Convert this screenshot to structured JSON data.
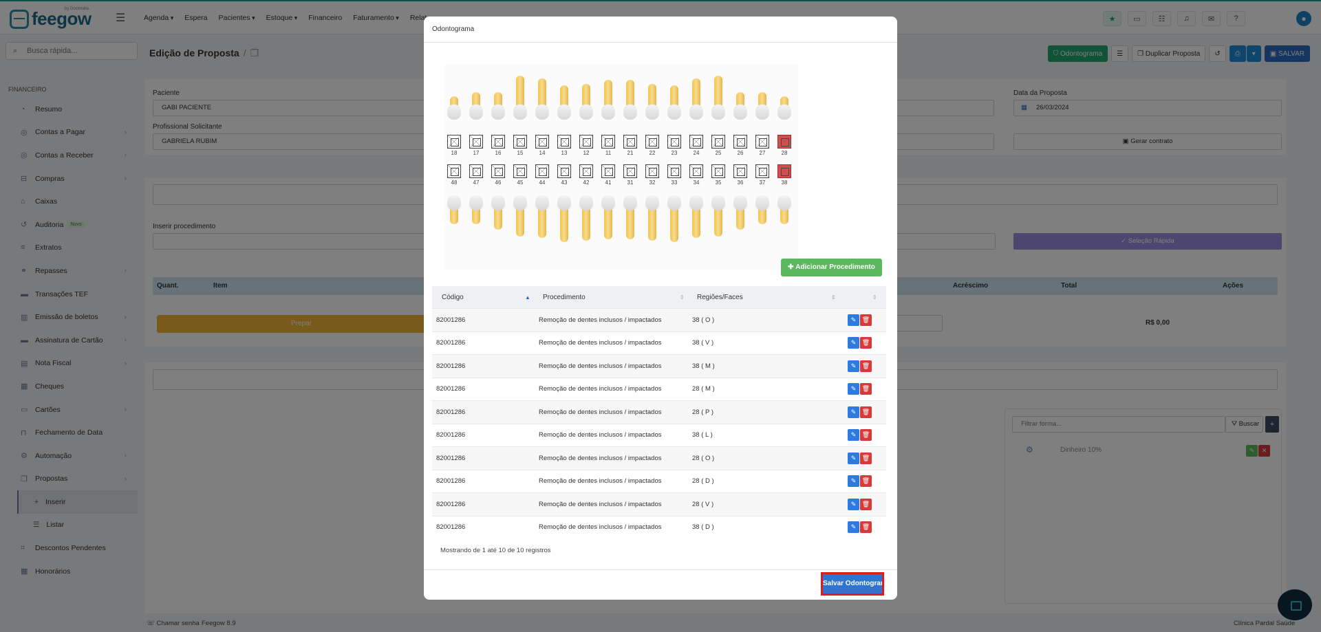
{
  "app": {
    "brand": "feegow",
    "brand_sub": "by Doctoralia"
  },
  "topnav": [
    "Agenda",
    "Espera",
    "Pacientes",
    "Estoque",
    "Financeiro",
    "Faturamento",
    "Relat"
  ],
  "sidebar": {
    "search_placeholder": "Busca rápida...",
    "section": "FINANCEIRO",
    "items": [
      {
        "label": "Resumo",
        "icon": "gauge-icon",
        "chevron": false
      },
      {
        "label": "Contas a Pagar",
        "icon": "coins-icon",
        "chevron": true
      },
      {
        "label": "Contas a Receber",
        "icon": "coins-icon",
        "chevron": true
      },
      {
        "label": "Compras",
        "icon": "cart-icon",
        "chevron": true
      },
      {
        "label": "Caixas",
        "icon": "inbox-icon",
        "chevron": false
      },
      {
        "label": "Auditoria",
        "icon": "history-icon",
        "chevron": false,
        "badge": "Novo"
      },
      {
        "label": "Extratos",
        "icon": "list-icon",
        "chevron": false
      },
      {
        "label": "Repasses",
        "icon": "handshake-icon",
        "chevron": true
      },
      {
        "label": "Transações TEF",
        "icon": "card-icon",
        "chevron": false
      },
      {
        "label": "Emissão de boletos",
        "icon": "barcode-icon",
        "chevron": true
      },
      {
        "label": "Assinatura de Cartão",
        "icon": "card-icon",
        "chevron": true
      },
      {
        "label": "Nota Fiscal",
        "icon": "document-icon",
        "chevron": true
      },
      {
        "label": "Cheques",
        "icon": "cheque-icon",
        "chevron": false
      },
      {
        "label": "Cartões",
        "icon": "cards-icon",
        "chevron": true
      },
      {
        "label": "Fechamento de Data",
        "icon": "lock-icon",
        "chevron": false
      },
      {
        "label": "Automação",
        "icon": "gears-icon",
        "chevron": true
      },
      {
        "label": "Propostas",
        "icon": "copy-icon",
        "chevron": true
      }
    ],
    "sub_items": [
      {
        "label": "Inserir",
        "icon": "+"
      },
      {
        "label": "Listar",
        "icon": "☰"
      }
    ],
    "items_after": [
      {
        "label": "Descontos Pendentes",
        "icon": "tag-icon"
      },
      {
        "label": "Honorários",
        "icon": "calendar-icon"
      }
    ]
  },
  "page": {
    "title": "Edição de Proposta",
    "separator": "/",
    "actions": {
      "odontograma": "Odontograma",
      "duplicar": "Duplicar Proposta",
      "salvar": "SALVAR"
    },
    "form": {
      "paciente_label": "Paciente",
      "paciente_value": "GABI PACIENTE",
      "profissional_label": "Profissional Solicitante",
      "profissional_value": "GABRIELA RUBIM",
      "data_label": "Data da Proposta",
      "data_value": "26/03/2024",
      "gerar_contrato": "Gerar contrato",
      "inserir_label": "Inserir procedimento",
      "selecao_rapida": "Seleção Rápida"
    },
    "table_head": {
      "quant": "Quant.",
      "item": "Item",
      "acrescimo": "Acréscimo",
      "total": "Total",
      "acoes": "Ações"
    },
    "total_value": "R$ 0,00",
    "yellow_btn": "Prepar",
    "filter_placeholder": "Filtrar forma...",
    "buscar": "Buscar",
    "payment_item": "Dinheiro 10%"
  },
  "modal": {
    "title": "Odontograma",
    "upper_teeth": [
      "18",
      "17",
      "16",
      "15",
      "14",
      "13",
      "12",
      "11",
      "21",
      "22",
      "23",
      "24",
      "25",
      "26",
      "27",
      "28"
    ],
    "lower_teeth": [
      "48",
      "47",
      "46",
      "45",
      "44",
      "43",
      "42",
      "41",
      "31",
      "32",
      "33",
      "34",
      "35",
      "36",
      "37",
      "38"
    ],
    "marked_teeth": [
      "28",
      "38"
    ],
    "add_button": "Adicionar Procedimento",
    "columns": {
      "codigo": "Código",
      "procedimento": "Procedimento",
      "regioes": "Regiões/Faces"
    },
    "rows": [
      {
        "codigo": "82001286",
        "procedimento": "Remoção de dentes inclusos / impactados",
        "regiao": "38 ( O )"
      },
      {
        "codigo": "82001286",
        "procedimento": "Remoção de dentes inclusos / impactados",
        "regiao": "38 ( V )"
      },
      {
        "codigo": "82001286",
        "procedimento": "Remoção de dentes inclusos / impactados",
        "regiao": "38 ( M )"
      },
      {
        "codigo": "82001286",
        "procedimento": "Remoção de dentes inclusos / impactados",
        "regiao": "28 ( M )"
      },
      {
        "codigo": "82001286",
        "procedimento": "Remoção de dentes inclusos / impactados",
        "regiao": "28 ( P )"
      },
      {
        "codigo": "82001286",
        "procedimento": "Remoção de dentes inclusos / impactados",
        "regiao": "38 ( L )"
      },
      {
        "codigo": "82001286",
        "procedimento": "Remoção de dentes inclusos / impactados",
        "regiao": "28 ( O )"
      },
      {
        "codigo": "82001286",
        "procedimento": "Remoção de dentes inclusos / impactados",
        "regiao": "28 ( D )"
      },
      {
        "codigo": "82001286",
        "procedimento": "Remoção de dentes inclusos / impactados",
        "regiao": "28 ( V )"
      },
      {
        "codigo": "82001286",
        "procedimento": "Remoção de dentes inclusos / impactados",
        "regiao": "38 ( D )"
      }
    ],
    "footer_info": "Mostrando de 1 até 10 de 10 registros",
    "save_button": "Salvar Odontograma"
  },
  "bottom": {
    "chamar_senha": "Chamar senha",
    "version": "Feegow 8.9",
    "clinic": "Clínica Pardal Saúde"
  }
}
